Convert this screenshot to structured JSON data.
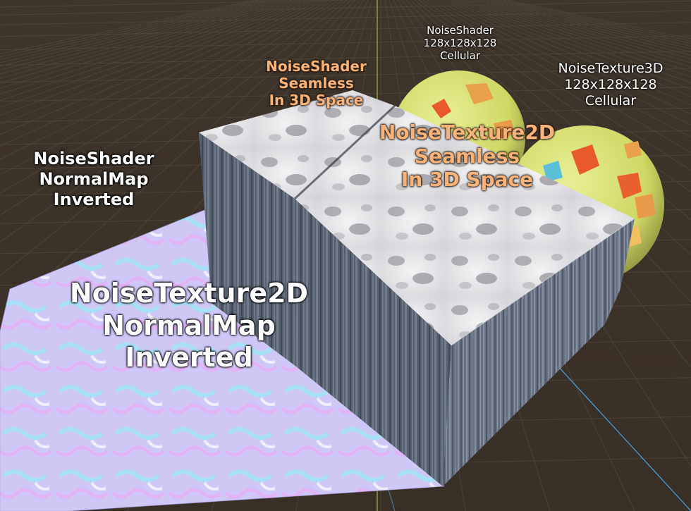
{
  "labels": {
    "noiseshader_normalmap": [
      "NoiseShader",
      "NormalMap",
      "Inverted"
    ],
    "noisetexture2d_normalmap": [
      "NoiseTexture2D",
      "NormalMap",
      "Inverted"
    ],
    "noiseshader_seamless": [
      "NoiseShader",
      "Seamless",
      "In 3D Space"
    ],
    "noisetexture2d_seamless": [
      "NoiseTexture2D",
      "Seamless",
      "In 3D Space"
    ],
    "noiseshader_cellular": [
      "NoiseShader",
      "128x128x128",
      "Cellular"
    ],
    "noisetexture3d_cellular": [
      "NoiseTexture3D",
      "128x128x128",
      "Cellular"
    ]
  },
  "colors": {
    "background": "#3b3229",
    "grid": "#5a5046",
    "axis_green": "#b6d34a",
    "axis_blue": "#4aa3e0",
    "label_white": "#ffffff",
    "label_orange": "#f7b37a",
    "normalmap_base": "#c9c3f5",
    "marble_top": "#e6e6e8",
    "box_side": "#5f6878",
    "sphere_base": "#d8e07a"
  },
  "scene_objects": [
    "normal-map-plane",
    "marble-box-left",
    "marble-box-right",
    "cellular-sphere-back",
    "cellular-sphere-front"
  ]
}
